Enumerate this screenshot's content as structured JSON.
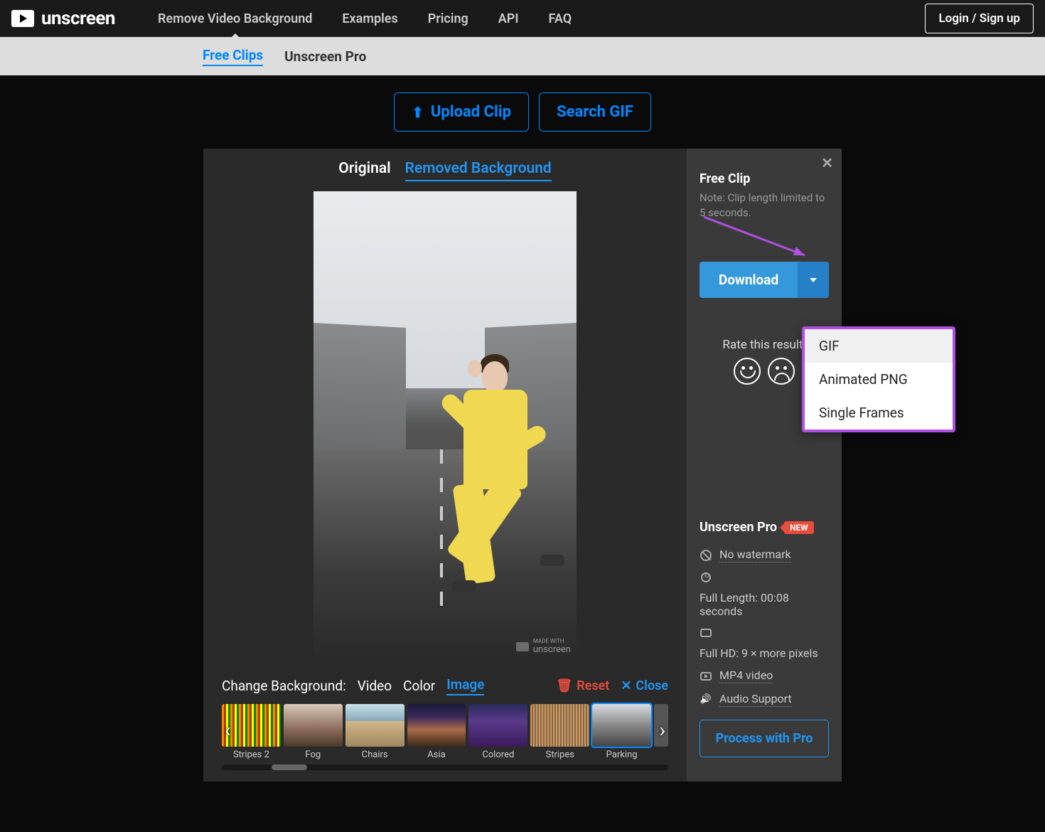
{
  "brand": "unscreen",
  "nav": {
    "items": [
      "Remove Video Background",
      "Examples",
      "Pricing",
      "API",
      "FAQ"
    ],
    "login": "Login / Sign up"
  },
  "subnav": {
    "free": "Free Clips",
    "pro": "Unscreen Pro"
  },
  "actions": {
    "upload": "Upload Clip",
    "search": "Search GIF"
  },
  "view_tabs": {
    "original": "Original",
    "removed": "Removed Background"
  },
  "watermark": {
    "prefix": "MADE WITH",
    "brand": "unscreen"
  },
  "bg": {
    "label": "Change Background:",
    "tabs": {
      "video": "Video",
      "color": "Color",
      "image": "Image"
    },
    "reset": "Reset",
    "close": "Close",
    "thumbs": [
      "Stripes 2",
      "Fog",
      "Chairs",
      "Asia",
      "Colored",
      "Stripes",
      "Parking"
    ]
  },
  "side": {
    "title": "Free Clip",
    "note": "Note: Clip length limited to 5 seconds.",
    "download": "Download",
    "rate": "Rate this result:",
    "dropdown": [
      "GIF",
      "Animated PNG",
      "Single Frames"
    ]
  },
  "pro": {
    "title": "Unscreen Pro",
    "badge": "NEW",
    "features": {
      "nowatermark": "No watermark",
      "length": "Full Length: 00:08 seconds",
      "hd": "Full HD: 9 × more pixels",
      "mp4": "MP4 video",
      "audio": "Audio Support"
    },
    "cta": "Process with Pro"
  }
}
